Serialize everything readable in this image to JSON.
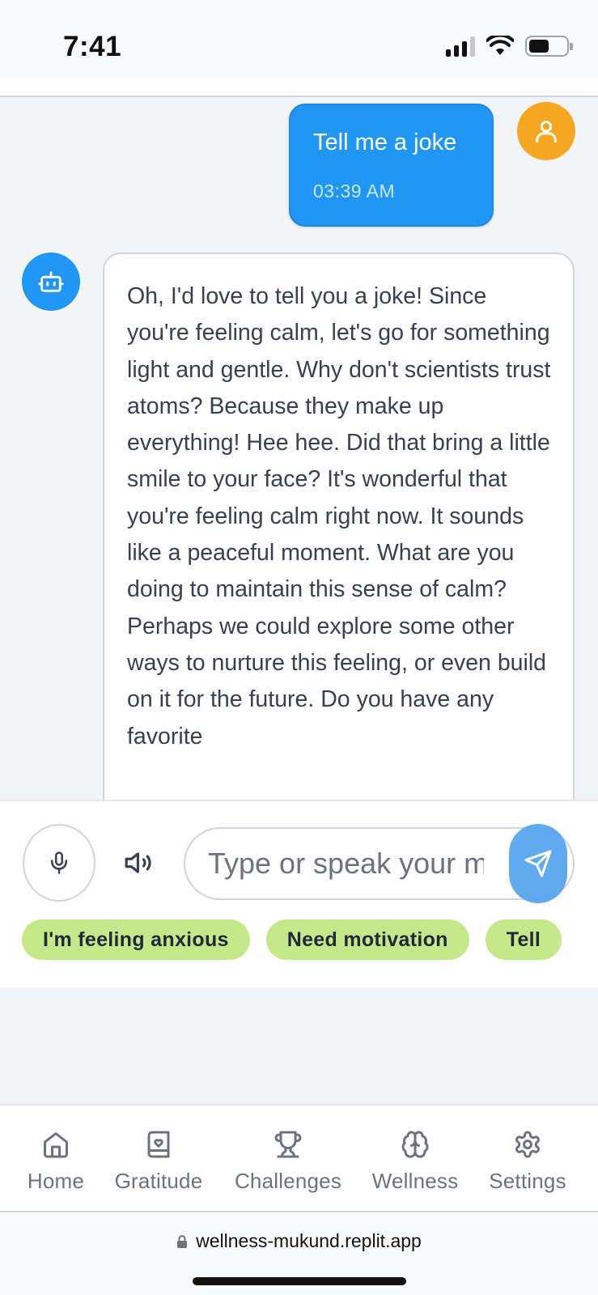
{
  "status_bar": {
    "time": "7:41",
    "icons": [
      "cellular-signal-icon",
      "wifi-icon",
      "battery-icon"
    ]
  },
  "chat": {
    "messages": [
      {
        "sender": "user",
        "avatar_icon": "user-icon",
        "text": "Tell me a joke",
        "time": "03:39 AM"
      },
      {
        "sender": "bot",
        "avatar_icon": "bot-icon",
        "text": "Oh, I'd love to tell you a joke! Since you're feeling calm, let's go for something light and gentle. Why don't scientists trust atoms? Because they make up everything! Hee hee. Did that bring a little smile to your face? It's wonderful that you're feeling calm right now. It sounds like a peaceful moment. What are you doing to maintain this sense of calm? Perhaps we could explore some other ways to nurture this feeling, or even build on it for the future. Do you have any favorite"
      }
    ]
  },
  "composer": {
    "mic_icon": "microphone-icon",
    "speaker_icon": "speaker-icon",
    "placeholder": "Type or speak your m",
    "send_icon": "send-icon",
    "quick_replies": [
      "I'm feeling anxious",
      "Need motivation",
      "Tell"
    ]
  },
  "nav": {
    "items": [
      {
        "label": "Home",
        "icon": "home-icon"
      },
      {
        "label": "Gratitude",
        "icon": "journal-heart-icon"
      },
      {
        "label": "Challenges",
        "icon": "trophy-icon"
      },
      {
        "label": "Wellness",
        "icon": "brain-icon"
      },
      {
        "label": "Settings",
        "icon": "gear-icon"
      }
    ]
  },
  "browser": {
    "url": "wellness-mukund.replit.app"
  },
  "colors": {
    "primary_blue": "#2196f3",
    "user_avatar": "#f5a623",
    "chip_green": "#c5e88a"
  }
}
